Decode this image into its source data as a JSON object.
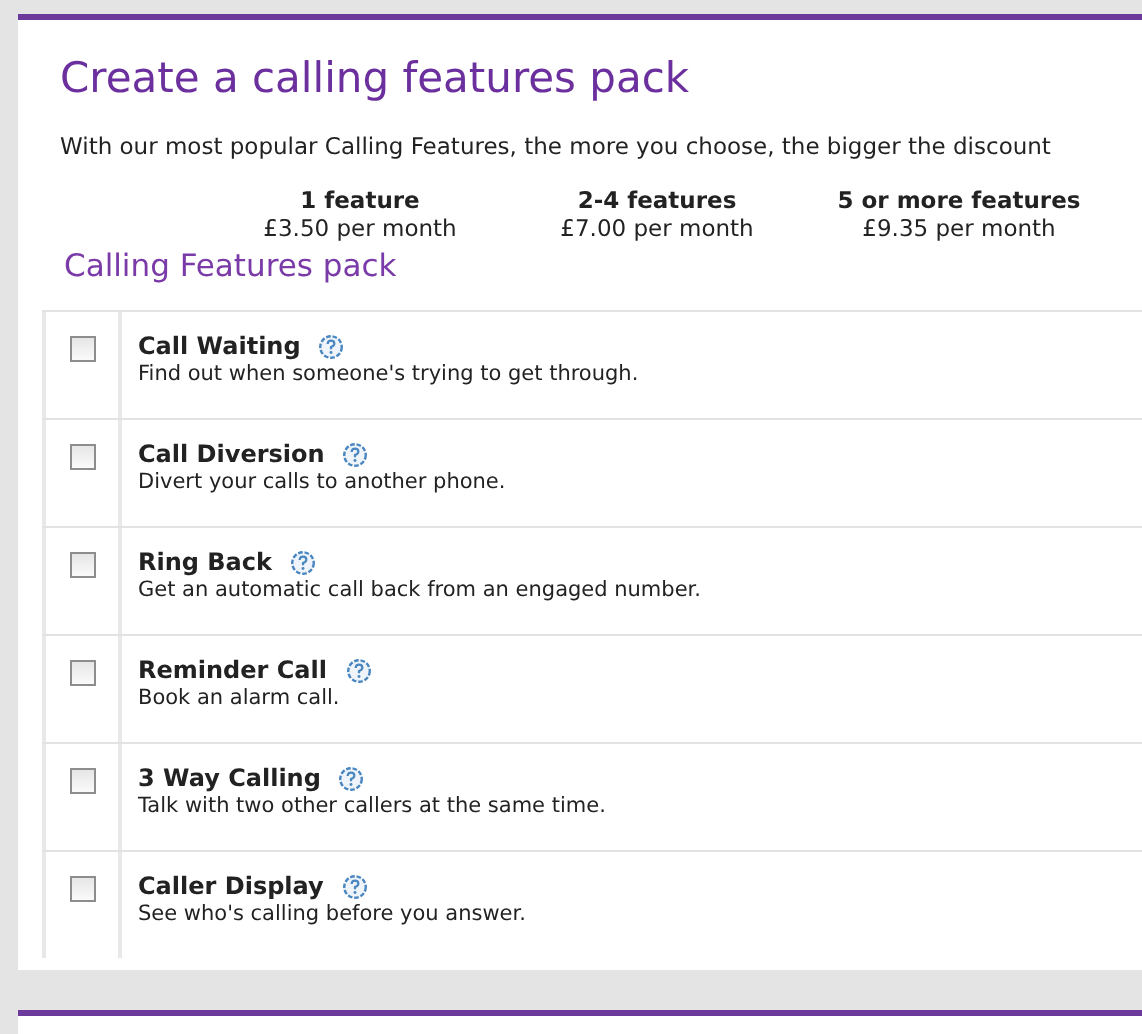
{
  "title": "Create a calling features pack",
  "intro": "With our most popular Calling Features, the more you choose, the bigger the discount",
  "tiers": [
    {
      "label": "1 feature",
      "price": "£3.50 per month"
    },
    {
      "label": "2-4 features",
      "price": "£7.00 per month"
    },
    {
      "label": "5 or more features",
      "price": "£9.35 per month"
    }
  ],
  "section_title": "Calling Features pack",
  "features": [
    {
      "name": "Call Waiting",
      "description": "Find out when someone's trying to get through.",
      "checked": false
    },
    {
      "name": "Call Diversion",
      "description": "Divert your calls to another phone.",
      "checked": false
    },
    {
      "name": "Ring Back",
      "description": "Get an automatic call back from an engaged number.",
      "checked": false
    },
    {
      "name": "Reminder Call",
      "description": "Book an alarm call.",
      "checked": false
    },
    {
      "name": "3 Way Calling",
      "description": "Talk with two other callers at the same time.",
      "checked": false
    },
    {
      "name": "Caller Display",
      "description": "See who's calling before you answer.",
      "checked": false
    }
  ]
}
